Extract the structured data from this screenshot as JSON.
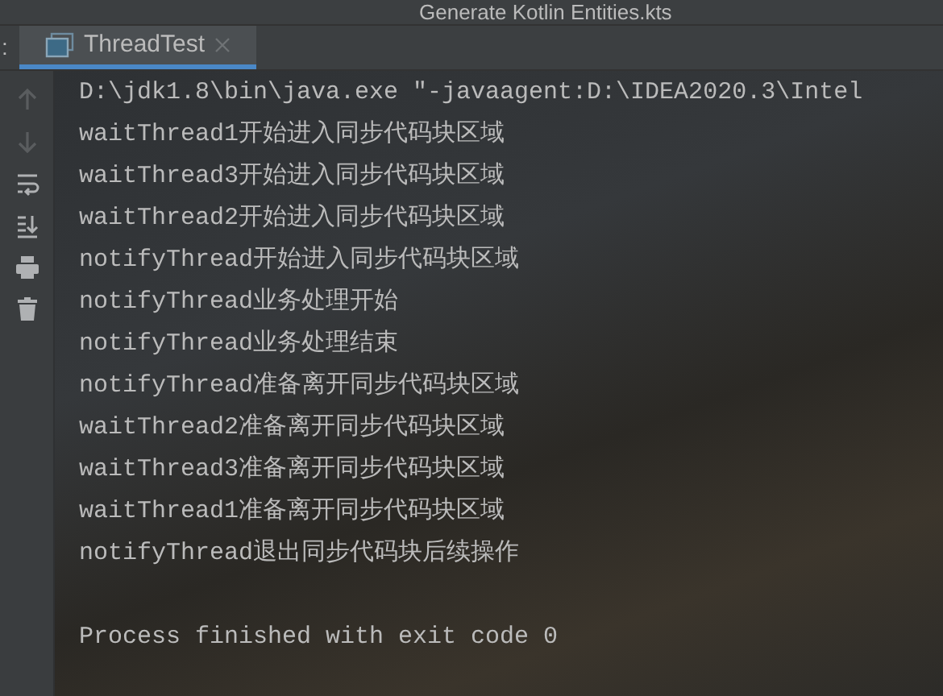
{
  "editor_tab_peek": {
    "label": "Generate Kotlin Entities.kts"
  },
  "run_panel": {
    "side_label": ":",
    "tabs": [
      {
        "label": "ThreadTest",
        "selected": true,
        "closable": true
      }
    ]
  },
  "toolbar": [
    {
      "kind": "up",
      "disabled": true
    },
    {
      "kind": "down",
      "disabled": true
    },
    {
      "kind": "wrap",
      "disabled": false
    },
    {
      "kind": "scroll-end",
      "disabled": false
    },
    {
      "kind": "print",
      "disabled": false
    },
    {
      "kind": "trash",
      "disabled": false
    }
  ],
  "console": [
    {
      "kind": "command",
      "text": "D:\\jdk1.8\\bin\\java.exe \"-javaagent:D:\\IDEA2020.3\\Intel"
    },
    {
      "kind": "output",
      "text": "waitThread1开始进入同步代码块区域"
    },
    {
      "kind": "output",
      "text": "waitThread3开始进入同步代码块区域"
    },
    {
      "kind": "output",
      "text": "waitThread2开始进入同步代码块区域"
    },
    {
      "kind": "output",
      "text": "notifyThread开始进入同步代码块区域"
    },
    {
      "kind": "output",
      "text": "notifyThread业务处理开始"
    },
    {
      "kind": "output",
      "text": "notifyThread业务处理结束"
    },
    {
      "kind": "output",
      "text": "notifyThread准备离开同步代码块区域"
    },
    {
      "kind": "output",
      "text": "waitThread2准备离开同步代码块区域"
    },
    {
      "kind": "output",
      "text": "waitThread3准备离开同步代码块区域"
    },
    {
      "kind": "output",
      "text": "waitThread1准备离开同步代码块区域"
    },
    {
      "kind": "output",
      "text": "notifyThread退出同步代码块后续操作"
    },
    {
      "kind": "exit",
      "text": "Process finished with exit code 0"
    }
  ]
}
